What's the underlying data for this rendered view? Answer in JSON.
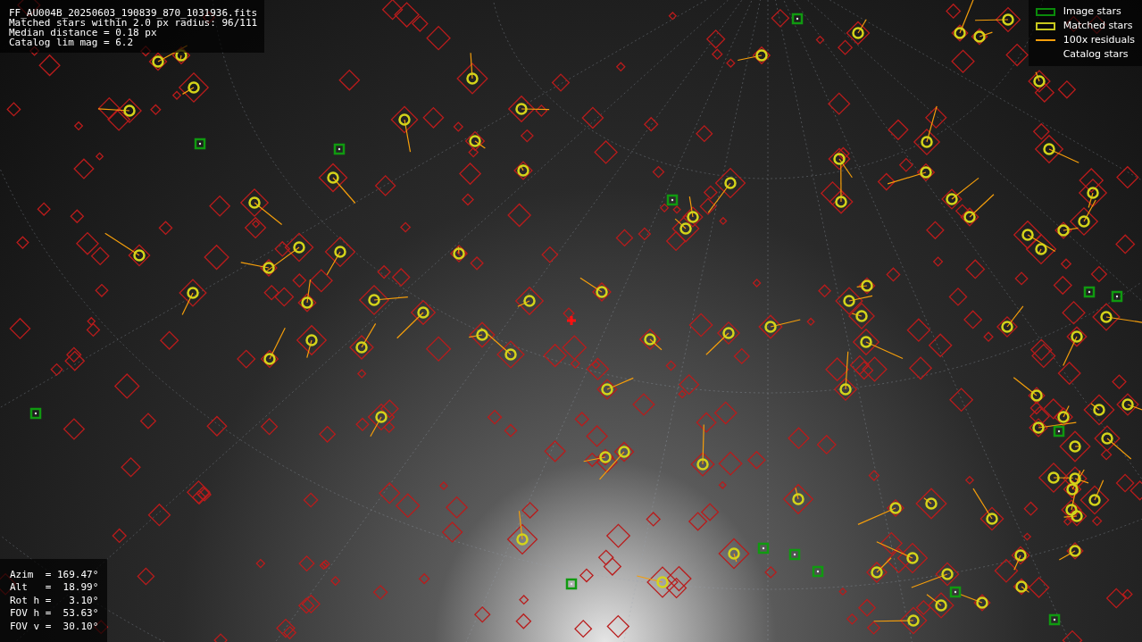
{
  "info": {
    "lines": [
      "FF_AU004B_20250603_190839_870_1031936.fits",
      "Matched stars within 2.0 px radius: 96/111",
      "Median distance = 0.18 px",
      "Catalog lim mag = 6.2"
    ]
  },
  "legend": [
    {
      "kind": "image",
      "label": "Image stars"
    },
    {
      "kind": "matched",
      "label": "Matched stars"
    },
    {
      "kind": "residual",
      "label": "100x residuals"
    },
    {
      "kind": "catalog",
      "label": "Catalog stars"
    }
  ],
  "parameters": [
    "Azim  = 169.47°",
    "Alt   =  18.99°",
    "Rot h =   3.10°",
    "FOV h =  53.63°",
    "FOV v =  30.10°"
  ]
}
